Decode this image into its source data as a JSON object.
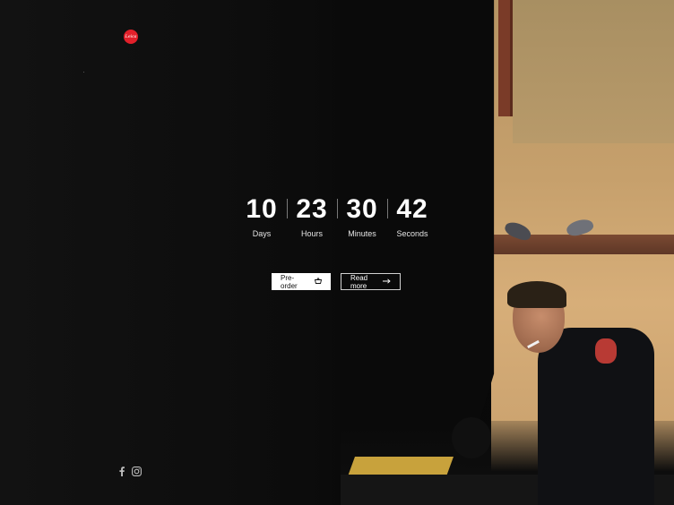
{
  "brand": {
    "logo_text": "Leica"
  },
  "countdown": {
    "units": [
      {
        "value": "10",
        "label": "Days"
      },
      {
        "value": "23",
        "label": "Hours"
      },
      {
        "value": "30",
        "label": "Minutes"
      },
      {
        "value": "42",
        "label": "Seconds"
      }
    ]
  },
  "actions": {
    "preorder": {
      "label": "Pre-order",
      "icon": "basket-icon"
    },
    "readmore": {
      "label": "Read more",
      "icon": "arrow-right-icon"
    }
  },
  "social": [
    {
      "name": "facebook",
      "icon": "facebook-icon"
    },
    {
      "name": "instagram",
      "icon": "instagram-icon"
    }
  ],
  "colors": {
    "brand_red": "#e2202a",
    "background": "#0b0b0b",
    "button_bg": "#ffffff"
  }
}
